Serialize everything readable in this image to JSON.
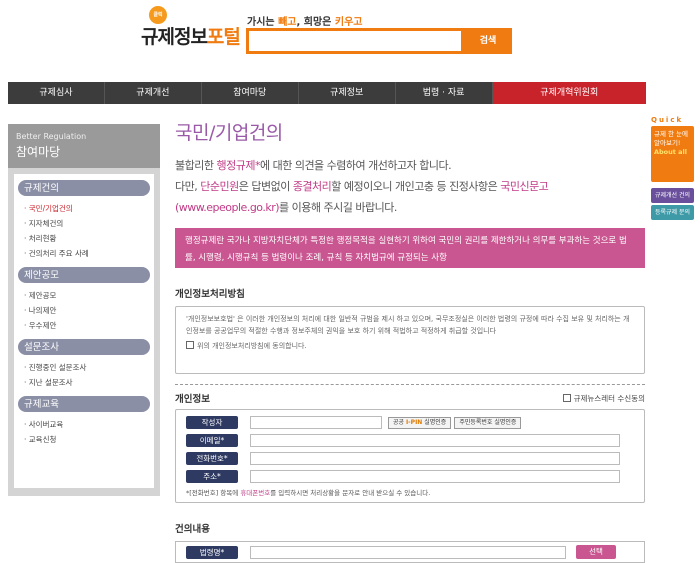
{
  "header": {
    "logo_badge": "클릭",
    "logo_text_a": "규제정보",
    "logo_text_b": "포털",
    "slogan": [
      "가시는 ",
      "빼고",
      ", 희망은 ",
      "키우고"
    ],
    "search_button": "검색"
  },
  "nav": [
    "규제심사",
    "규제개선",
    "참여마당",
    "규제정보",
    "법령 · 자료",
    "규제개혁위원회"
  ],
  "sidebar": {
    "title_en": "Better Regulation",
    "title_ko": "참여마당",
    "sections": [
      {
        "label": "규제건의",
        "items": [
          "국민/기업건의",
          "지자체건의",
          "처리현황",
          "건의처리 주요 사례"
        ]
      },
      {
        "label": "제안공모",
        "items": [
          "제안공모",
          "나의제안",
          "우수제안"
        ]
      },
      {
        "label": "설문조사",
        "items": [
          "진행중인 설문조사",
          "지난 설문조사"
        ]
      },
      {
        "label": "규제교육",
        "items": [
          "사이버교육",
          "교육신청"
        ]
      }
    ]
  },
  "main": {
    "title": "국민/기업건의",
    "intro": {
      "l1a": "불합리한 ",
      "l1b": "행정규제*",
      "l1c": "에 대한 의견을 수렴하여 개선하고자 합니다.",
      "l2a": "다만, ",
      "l2b": "단순민원",
      "l2c": "은 답변없이 ",
      "l2d": "종결처리",
      "l2e": "할 예정이오니 개인고충 등 진정사항은 ",
      "l2f": "국민신문고",
      "l3a": "(www.epeople.go.kr)",
      "l3b": "를 이용해 주시길 바랍니다."
    },
    "notice": "행정규제란 국가나 지방자치단체가 특정한 행정목적을 실현하기 위하여 국민의 권리를 제한하거나 의무를 부과하는 것으로 법률, 시행령, 시행규칙 등 법령이나 조례, 규칙 등 자치법규에 규정되는 사항",
    "privacy_title": "개인정보처리방침",
    "privacy_text": "'개인정보보호법' 은 이러한 개인정보의 처리에 대한 일반적 규범을 제시 하고 있으며, 국무조정실은 이러한 법령의 규정에 따라 수집 보유 및 처리하는 개인정보를 공공업무의 적절한 수행과 정보주체의 권익을 보호 하기 위해 적법하고 적정하게 취급할 것입니다",
    "privacy_agree": "위의 개인정보처리방침에 동의합니다.",
    "info_title": "개인정보",
    "newsletter": "규제뉴스레터 수신동의",
    "fields": {
      "author": "작성자",
      "email": "이메일*",
      "phone": "전화번호*",
      "address": "주소*"
    },
    "ipin": [
      "공공 ",
      "I-PIN",
      " 실명인증"
    ],
    "rrn_verify": "주민등록번호 실명인증",
    "note": [
      "*[전화번호] 항목에 ",
      "휴대폰번호",
      "를 입력하시면 처리상황을 문자로 안내 받으실 수 있습니다."
    ],
    "content_title": "건의내용",
    "law_label": "법령명*",
    "select_button": "선택"
  },
  "quick": {
    "label": "Quick",
    "tab": [
      "규제 한 눈에",
      "알아보기!",
      "About all"
    ],
    "btn1": "규제개선 건의",
    "btn2": "등록규제 문의"
  }
}
